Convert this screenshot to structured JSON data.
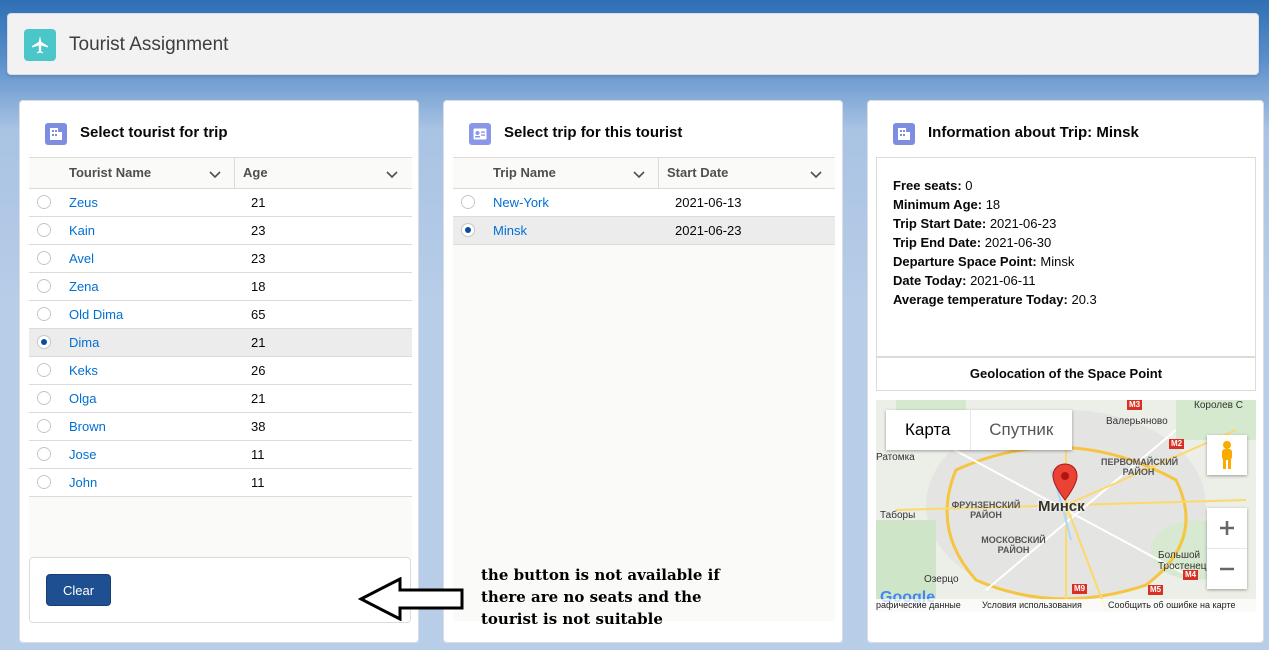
{
  "app": {
    "title": "Tourist Assignment",
    "icon": "airplane-icon",
    "icon_color": "#4bc6c9"
  },
  "tourists_card": {
    "title": "Select tourist for trip",
    "icon": "building-icon",
    "columns": [
      "Tourist Name",
      "Age"
    ],
    "rows": [
      {
        "name": "Zeus",
        "age": "21",
        "selected": false
      },
      {
        "name": "Kain",
        "age": "23",
        "selected": false
      },
      {
        "name": "Avel",
        "age": "23",
        "selected": false
      },
      {
        "name": "Zena",
        "age": "18",
        "selected": false
      },
      {
        "name": "Old Dima",
        "age": "65",
        "selected": false
      },
      {
        "name": "Dima",
        "age": "21",
        "selected": true
      },
      {
        "name": "Keks",
        "age": "26",
        "selected": false
      },
      {
        "name": "Olga",
        "age": "21",
        "selected": false
      },
      {
        "name": "Brown",
        "age": "38",
        "selected": false
      },
      {
        "name": "Jose",
        "age": "11",
        "selected": false
      },
      {
        "name": "John",
        "age": "11",
        "selected": false
      }
    ],
    "clear_label": "Clear"
  },
  "trips_card": {
    "title": "Select trip for this tourist",
    "icon": "contact-card-icon",
    "columns": [
      "Trip Name",
      "Start Date"
    ],
    "rows": [
      {
        "name": "New-York",
        "date": "2021-06-13",
        "selected": false
      },
      {
        "name": "Minsk",
        "date": "2021-06-23",
        "selected": true
      }
    ]
  },
  "info_card": {
    "title": "Information about Trip: Minsk",
    "icon": "building-icon",
    "fields": [
      {
        "label": "Free seats:",
        "value": "0"
      },
      {
        "label": "Minimum Age:",
        "value": "18"
      },
      {
        "label": "Trip Start Date:",
        "value": "2021-06-23"
      },
      {
        "label": "Trip End Date:",
        "value": "2021-06-30"
      },
      {
        "label": "Departure Space Point:",
        "value": "Minsk"
      },
      {
        "label": "Date Today:",
        "value": "2021-06-11"
      },
      {
        "label": "Average temperature Today:",
        "value": "20.3"
      }
    ],
    "geo_button": "Geolocation of the Space Point",
    "map": {
      "map_tab": "Карта",
      "satellite_tab": "Спутник",
      "city": "Минск",
      "labels": [
        "Валерьяново",
        "Ратомка",
        "Таборы",
        "Озерцо",
        "Большой Тростенец",
        "Королев С"
      ],
      "districts": [
        "ПЕРВОМАЙСКИЙ РАЙОН",
        "ФРУНЗЕНСКИЙ РАЙОН",
        "МОСКОВСКИЙ РАЙОН"
      ],
      "roads": [
        "M3",
        "M2",
        "M4",
        "M9",
        "M5"
      ],
      "footer": [
        "рафические данные",
        "Условия использования",
        "Сообщить об ошибке на карте"
      ],
      "google": "Google"
    }
  },
  "annotation": "the button is not available if there are no seats and the tourist is not suitable"
}
